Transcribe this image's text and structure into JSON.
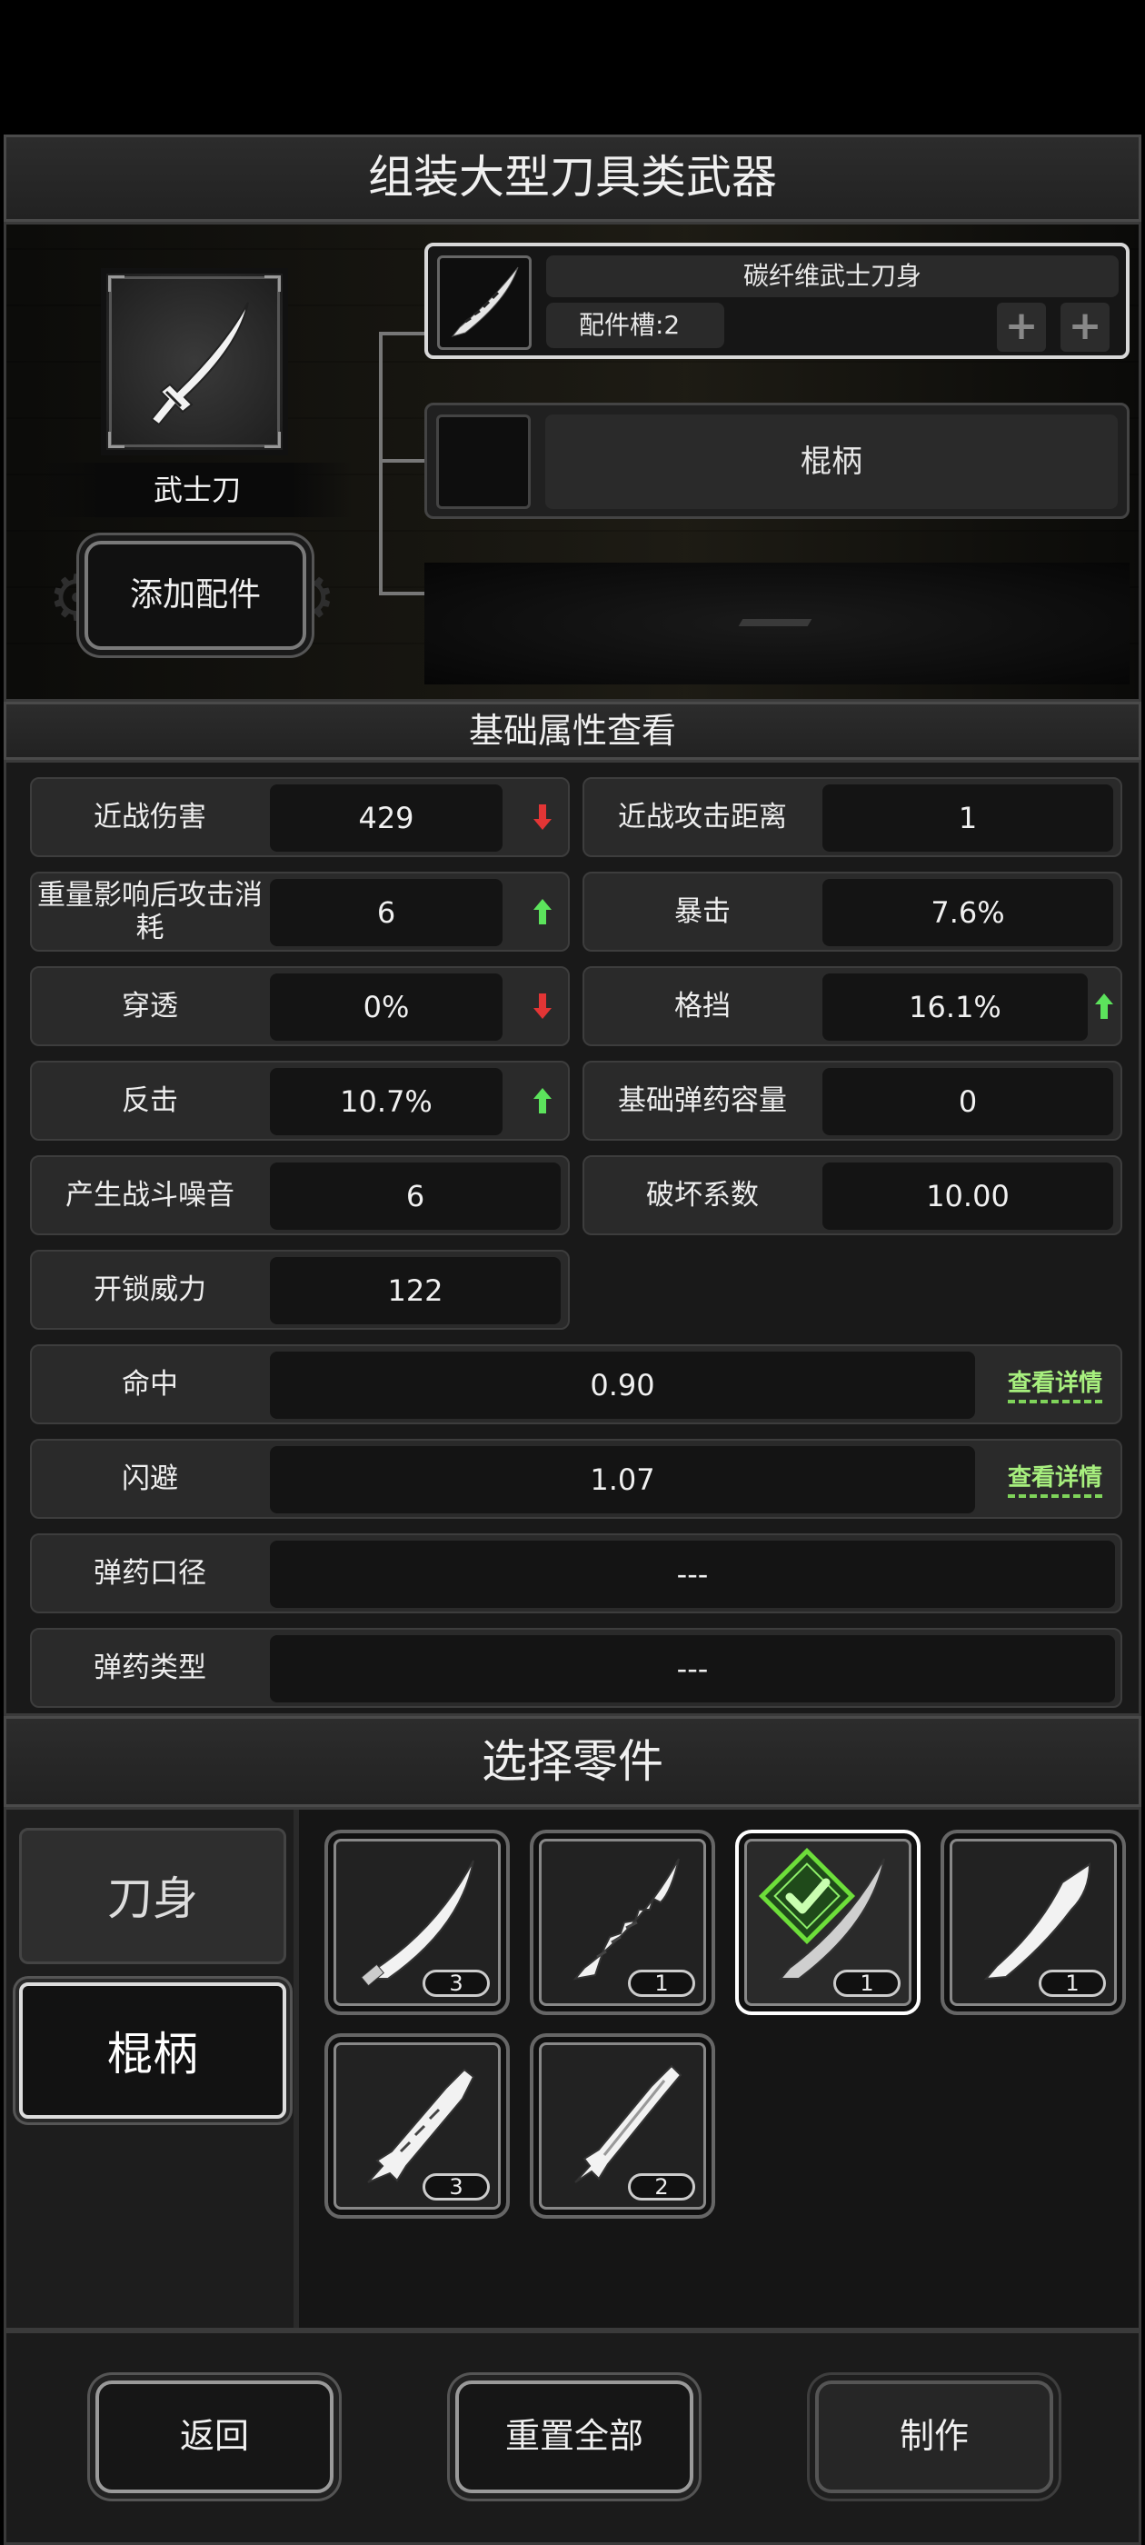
{
  "header": {
    "title": "组装大型刀具类武器"
  },
  "assembly": {
    "weapon_name": "武士刀",
    "add_button": "添加配件",
    "slots": [
      {
        "name": "碳纤维武士刀身",
        "slot_label": "配件槽:2"
      },
      {
        "name": "棍柄"
      }
    ],
    "empty_slot_mark": "—"
  },
  "stats": {
    "title": "基础属性查看",
    "detail_label": "查看详情",
    "items": [
      {
        "label": "近战伤害",
        "value": "429",
        "trend": "down"
      },
      {
        "label": "近战攻击距离",
        "value": "1"
      },
      {
        "label": "重量影响后攻击消耗",
        "value": "6",
        "trend": "up"
      },
      {
        "label": "暴击",
        "value": "7.6%"
      },
      {
        "label": "穿透",
        "value": "0%",
        "trend": "down"
      },
      {
        "label": "格挡",
        "value": "16.1%",
        "trend": "up"
      },
      {
        "label": "反击",
        "value": "10.7%",
        "trend": "up"
      },
      {
        "label": "基础弹药容量",
        "value": "0"
      },
      {
        "label": "产生战斗噪音",
        "value": "6"
      },
      {
        "label": "破坏系数",
        "value": "10.00"
      },
      {
        "label": "开锁威力",
        "value": "122"
      },
      {
        "label": "命中",
        "value": "0.90"
      },
      {
        "label": "闪避",
        "value": "1.07"
      },
      {
        "label": "弹药口径",
        "value": "---"
      },
      {
        "label": "弹药类型",
        "value": "---"
      }
    ]
  },
  "parts": {
    "title": "选择零件",
    "categories": [
      {
        "label": "刀身",
        "selected": true
      },
      {
        "label": "棍柄",
        "selected": false
      }
    ],
    "items": [
      {
        "count": "3",
        "selected": false
      },
      {
        "count": "1",
        "selected": false
      },
      {
        "count": "1",
        "selected": true
      },
      {
        "count": "1",
        "selected": false
      },
      {
        "count": "3",
        "selected": false
      },
      {
        "count": "2",
        "selected": false
      }
    ]
  },
  "footer": {
    "back": "返回",
    "reset": "重置全部",
    "craft": "制作"
  },
  "colors": {
    "trend_up": "#5ce35c",
    "trend_down": "#e23535",
    "detail_link": "#a7ef7e",
    "check": "#6dde3a"
  }
}
